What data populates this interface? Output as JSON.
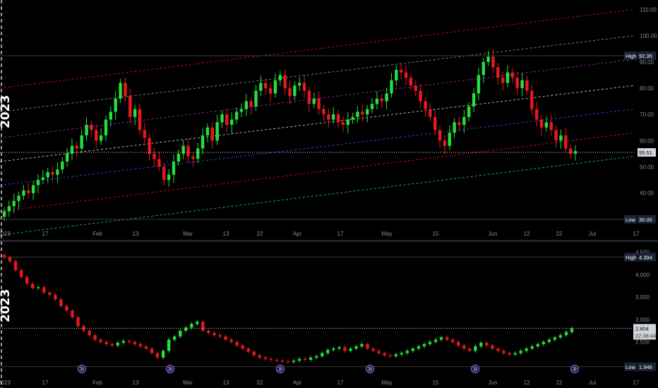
{
  "colors": {
    "background": "#000000",
    "up": "#22e13a",
    "down": "#e8181e",
    "axis_text": "#8c8c8c",
    "tag_bg": "#1c2336"
  },
  "chart_data": [
    {
      "type": "candlestick",
      "year_label": "2023",
      "x_labels": [
        "2023",
        "17",
        "Feb",
        "13",
        "Mar",
        "13",
        "22",
        "Apr",
        "17",
        "May",
        "15",
        "Jun",
        "12",
        "22",
        "Jul",
        "17"
      ],
      "y_ticks": [
        40,
        50,
        60,
        70,
        80,
        90,
        100,
        110
      ],
      "y_tick_labels": [
        "40.00",
        "50.00",
        "60.00",
        "70.00",
        "80.00",
        "90.00",
        "100.00",
        "110.00"
      ],
      "ylim": [
        27,
        112
      ],
      "high_label": "High",
      "high_value": "92.35",
      "low_label": "Low",
      "low_value": "30.00",
      "last_value": "55.51",
      "channel_lines": [
        {
          "color": "#e8181e",
          "start": 80,
          "end": 110
        },
        {
          "color": "#9d9d9d",
          "start": 71,
          "end": 100
        },
        {
          "color": "#c026d3",
          "start": 61,
          "end": 91
        },
        {
          "color": "#e5e5e5",
          "start": 52,
          "end": 81
        },
        {
          "color": "#2962ff",
          "start": 43,
          "end": 72
        },
        {
          "color": "#e8181e",
          "start": 33,
          "end": 63
        },
        {
          "color": "#22e13a",
          "start": 24,
          "end": 54
        }
      ],
      "closes": [
        33,
        35,
        37,
        39,
        41,
        40,
        43,
        45,
        46,
        48,
        47,
        49,
        52,
        55,
        58,
        57,
        62,
        66,
        64,
        60,
        62,
        68,
        71,
        76,
        82,
        77,
        69,
        72,
        64,
        61,
        55,
        53,
        50,
        45,
        47,
        52,
        55,
        58,
        54,
        53,
        57,
        62,
        65,
        60,
        67,
        70,
        66,
        68,
        71,
        72,
        75,
        73,
        79,
        82,
        80,
        78,
        83,
        85,
        80,
        77,
        81,
        82,
        79,
        74,
        76,
        72,
        70,
        68,
        70,
        67,
        66,
        68,
        69,
        71,
        70,
        72,
        74,
        76,
        75,
        78,
        83,
        87,
        86,
        84,
        81,
        79,
        75,
        72,
        69,
        64,
        60,
        58,
        63,
        67,
        66,
        69,
        73,
        78,
        85,
        90,
        92,
        88,
        84,
        82,
        86,
        84,
        80,
        83,
        79,
        72,
        68,
        65,
        67,
        64,
        60,
        62,
        57,
        55,
        56
      ],
      "opens": [
        31,
        33,
        35,
        37,
        39,
        41,
        40,
        43,
        45,
        46,
        48,
        47,
        49,
        52,
        55,
        58,
        57,
        62,
        66,
        64,
        60,
        62,
        68,
        71,
        76,
        82,
        77,
        69,
        72,
        64,
        61,
        55,
        53,
        50,
        45,
        47,
        52,
        55,
        58,
        54,
        53,
        57,
        62,
        65,
        60,
        67,
        70,
        66,
        68,
        71,
        72,
        75,
        73,
        79,
        82,
        80,
        78,
        83,
        85,
        80,
        77,
        81,
        82,
        79,
        74,
        76,
        72,
        70,
        68,
        70,
        67,
        66,
        68,
        69,
        71,
        70,
        72,
        74,
        76,
        75,
        78,
        83,
        87,
        86,
        84,
        81,
        79,
        75,
        72,
        69,
        64,
        60,
        58,
        63,
        67,
        66,
        69,
        73,
        78,
        85,
        90,
        92,
        88,
        84,
        82,
        86,
        84,
        80,
        83,
        79,
        72,
        68,
        65,
        67,
        64,
        60,
        62,
        57,
        55
      ]
    },
    {
      "type": "line",
      "year_label": "2023",
      "x_labels": [
        "2023",
        "17",
        "Feb",
        "13",
        "Mar",
        "13",
        "22",
        "Apr",
        "17",
        "May",
        "15",
        "Jun",
        "12",
        "22",
        "Jul",
        "17"
      ],
      "y_ticks": [
        2.5,
        3.0,
        3.5,
        4.0,
        4.5
      ],
      "y_tick_labels": [
        "2.500",
        "3.000",
        "3.500",
        "4.000",
        "4.500"
      ],
      "ylim": [
        1.88,
        4.62
      ],
      "high_label": "High",
      "high_value": "4.394",
      "low_label": "Low",
      "low_value": "1.946",
      "last_value": "2.804",
      "countdown": "22:38:44",
      "values": [
        4.39,
        4.3,
        4.1,
        3.95,
        3.8,
        3.7,
        3.72,
        3.6,
        3.55,
        3.45,
        3.3,
        3.2,
        3.05,
        2.85,
        2.75,
        2.65,
        2.55,
        2.5,
        2.45,
        2.42,
        2.48,
        2.52,
        2.5,
        2.45,
        2.4,
        2.35,
        2.25,
        2.15,
        2.3,
        2.55,
        2.62,
        2.75,
        2.82,
        2.9,
        2.95,
        2.75,
        2.7,
        2.65,
        2.62,
        2.55,
        2.5,
        2.42,
        2.35,
        2.28,
        2.2,
        2.15,
        2.12,
        2.1,
        2.08,
        2.06,
        2.05,
        2.08,
        2.12,
        2.1,
        2.15,
        2.18,
        2.25,
        2.32,
        2.35,
        2.38,
        2.3,
        2.35,
        2.4,
        2.45,
        2.35,
        2.3,
        2.25,
        2.2,
        2.18,
        2.22,
        2.25,
        2.3,
        2.35,
        2.4,
        2.45,
        2.5,
        2.55,
        2.6,
        2.55,
        2.5,
        2.42,
        2.35,
        2.3,
        2.4,
        2.48,
        2.42,
        2.35,
        2.3,
        2.25,
        2.22,
        2.25,
        2.3,
        2.35,
        2.4,
        2.45,
        2.5,
        2.55,
        2.6,
        2.65,
        2.72,
        2.8
      ]
    }
  ]
}
